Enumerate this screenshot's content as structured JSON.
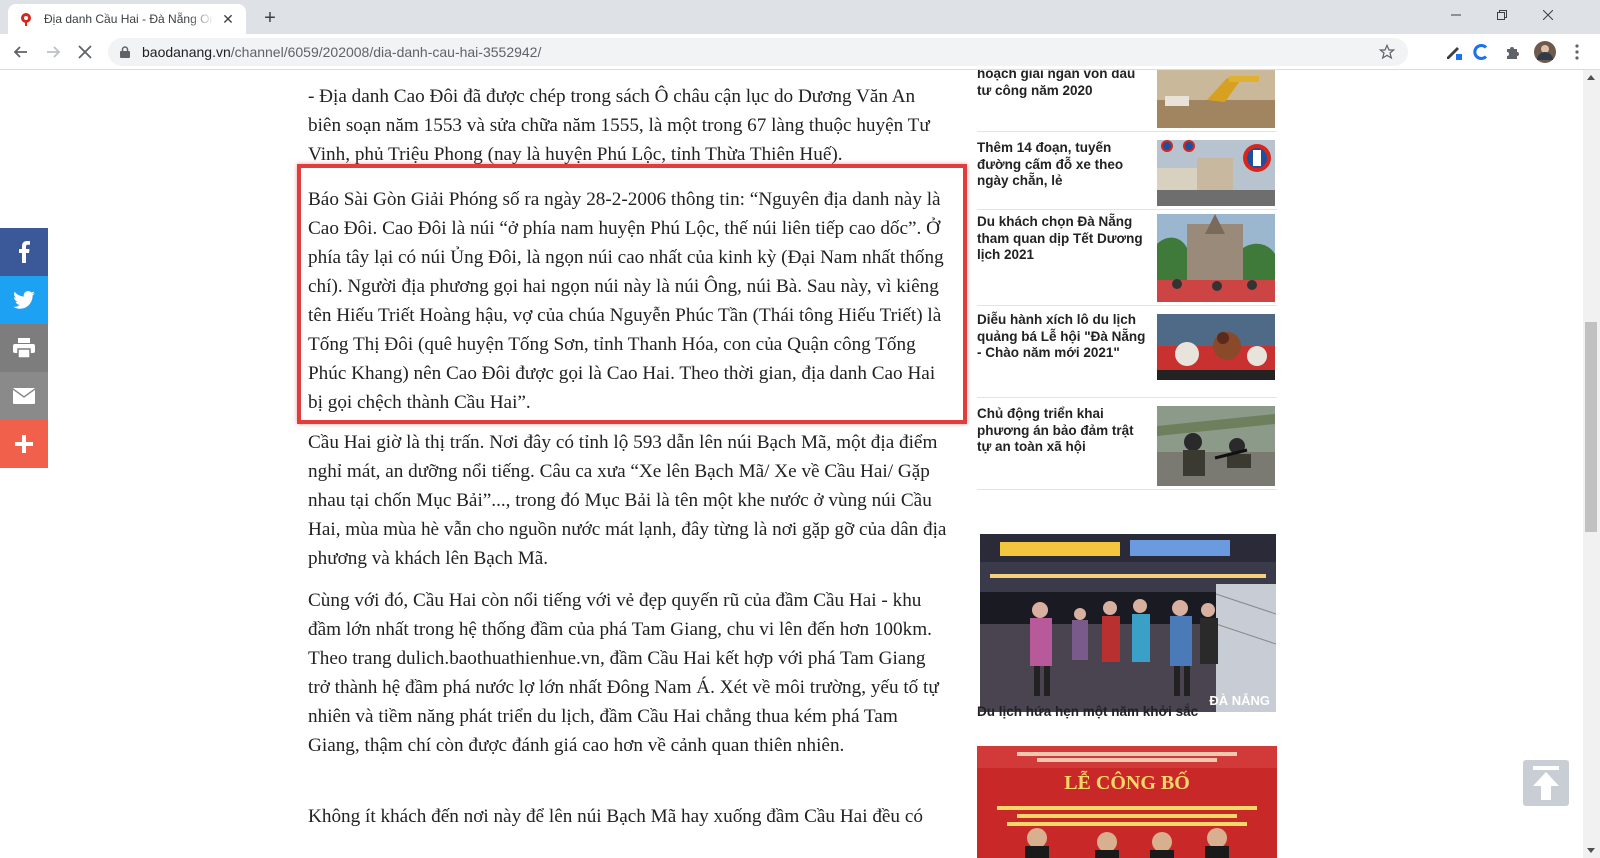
{
  "browser": {
    "tab_title": "Địa danh Cầu Hai - Đà Nẵng Online",
    "new_tab": "+",
    "url_host": "baodanang.vn",
    "url_path": "/channel/6059/202008/dia-danh-cau-hai-3552942/",
    "accent": "#1a73e8"
  },
  "article": {
    "paragraphs": [
      "- Địa danh Cao Đôi đã được chép trong sách Ô châu cận lục do Dương Văn An biên soạn năm 1553 và sửa chữa năm 1555, là một trong 67 làng thuộc huyện Tư Vinh, phủ Triệu Phong (nay là huyện Phú Lộc, tỉnh Thừa Thiên Huế).",
      "Báo Sài Gòn Giải Phóng số ra ngày 28-2-2006 thông tin: “Nguyên địa danh này là Cao Đôi. Cao Đôi là núi “ở phía nam huyện Phú Lộc, thế núi liên tiếp cao dốc”. Ở phía tây lại có núi Ủng Đôi, là ngọn núi cao nhất của kinh kỳ (Đại Nam nhất thống chí). Người địa phương gọi hai ngọn núi này là núi Ông, núi Bà. Sau này, vì kiêng tên Hiếu Triết Hoàng hậu, vợ của chúa Nguyễn Phúc Tần (Thái tông Hiếu Triết) là Tống Thị Đôi (quê huyện Tống Sơn, tỉnh Thanh Hóa, con của Quận công Tống Phúc Khang) nên Cao Đôi được gọi là Cao Hai. Theo thời gian, địa danh Cao Hai bị gọi chệch thành Cầu Hai”.",
      "Cầu Hai giờ là thị trấn. Nơi đây có tỉnh lộ 593 dẫn lên núi Bạch Mã, một địa điểm nghỉ mát, an dưỡng nổi tiếng. Câu ca xưa “Xe lên Bạch Mã/ Xe về Cầu Hai/ Gặp nhau tại chốn Mục Bải”..., trong đó Mục Bải là tên một khe nước ở vùng núi Cầu Hai, mùa mùa hè vẫn cho nguồn nước mát lạnh, đây từng là nơi gặp gỡ của dân địa phương và khách lên Bạch Mã.",
      "Cùng với đó, Cầu Hai còn nổi tiếng với vẻ đẹp quyến rũ của đầm Cầu Hai - khu đầm lớn nhất trong hệ thống đầm của phá Tam Giang, chu vi lên đến hơn 100km. Theo trang dulich.baothuathienhue.vn, đầm Cầu Hai kết hợp với phá Tam Giang trở thành hệ đầm phá nước lợ lớn nhất Đông Nam Á. Xét về môi trường, yếu tố tự nhiên và tiềm năng phát triển du lịch, đầm Cầu Hai chẳng thua kém phá Tam Giang, thậm chí còn được đánh giá cao hơn về cảnh quan thiên nhiên.",
      "Không ít khách đến nơi này để lên núi Bạch Mã hay xuống đầm Cầu Hai đều có"
    ],
    "highlight_color": "#e23d3d"
  },
  "sidebar": {
    "items": [
      {
        "title": "hoạch giải ngân vốn đầu tư công năm 2020"
      },
      {
        "title": "Thêm 14 đoạn, tuyến đường cấm đỗ xe theo ngày chẵn, lẻ"
      },
      {
        "title": "Du khách chọn Đà Nẵng tham quan dịp Tết Dương lịch 2021"
      },
      {
        "title": "Diễu hành xích lô du lịch quảng bá Lễ hội \"Đà Nẵng - Chào năm mới 2021\""
      },
      {
        "title": "Chủ động triển khai phương án bảo đảm trật tự an toàn xã hội"
      }
    ],
    "featured_caption": "Du lịch hứa hẹn một năm khởi sắc",
    "featured_watermark": "ĐÀ NẴNG",
    "banner_title": "LỄ CÔNG BỐ"
  },
  "share": {
    "colors": {
      "facebook": "#3b5998",
      "twitter": "#1da1f2",
      "print": "#7d7d7d",
      "email": "#8a8a8a",
      "more": "#f0604a"
    }
  }
}
